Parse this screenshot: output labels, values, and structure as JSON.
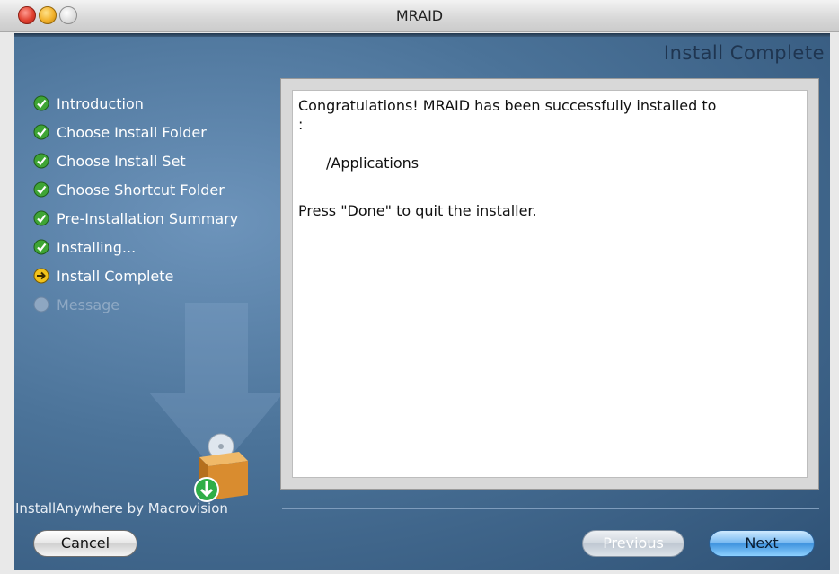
{
  "window": {
    "title": "MRAID"
  },
  "header": {
    "title": "Install Complete"
  },
  "steps": [
    {
      "label": "Introduction",
      "status": "done",
      "icon": "check-circle-icon"
    },
    {
      "label": "Choose Install Folder",
      "status": "done",
      "icon": "check-circle-icon"
    },
    {
      "label": "Choose Install Set",
      "status": "done",
      "icon": "check-circle-icon"
    },
    {
      "label": "Choose Shortcut Folder",
      "status": "done",
      "icon": "check-circle-icon"
    },
    {
      "label": "Pre-Installation Summary",
      "status": "done",
      "icon": "check-circle-icon"
    },
    {
      "label": "Installing...",
      "status": "done",
      "icon": "check-circle-icon"
    },
    {
      "label": "Install Complete",
      "status": "current",
      "icon": "arrow-circle-icon"
    },
    {
      "label": "Message",
      "status": "pending",
      "icon": "empty-circle-icon"
    }
  ],
  "content": {
    "line1": "Congratulations! MRAID has been successfully installed to",
    "line1_cont": ":",
    "path": "/Applications",
    "line2": "Press \"Done\" to quit the installer."
  },
  "footer": {
    "vendor": "InstallAnywhere by Macrovision",
    "cancel_label": "Cancel",
    "previous_label": "Previous",
    "next_label": "Next"
  },
  "colors": {
    "panel_bg": "#4b7399",
    "done": "#3fa535",
    "current": "#f2c31b",
    "next_button": "#3f93de"
  }
}
